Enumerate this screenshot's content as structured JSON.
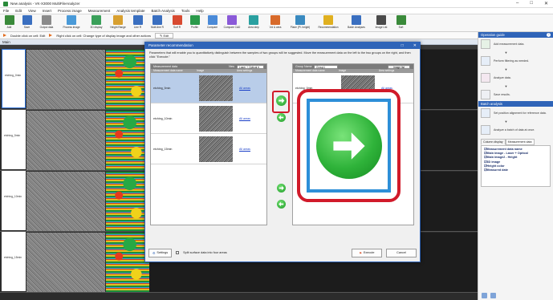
{
  "window": {
    "title": "New analysis - VK-X3000 MultiFileAnalyzer",
    "controls": [
      "–",
      "□",
      "✕"
    ]
  },
  "menu": [
    "File",
    "Edit",
    "View",
    "Insert",
    "Process image",
    "Measurement",
    "Analysis template",
    "Batch Analysis",
    "Tools",
    "Help"
  ],
  "ribbon": [
    {
      "label": "Add",
      "color": "#3a8a3a"
    },
    {
      "label": "Save",
      "color": "#3a6fc0"
    },
    {
      "label": "Output data",
      "color": "#8a8a8a"
    },
    {
      "label": "Process image",
      "color": "#4a9ad8"
    },
    {
      "label": "3D display",
      "color": "#3aa05a"
    },
    {
      "label": "Height Range",
      "color": "#d8a030"
    },
    {
      "label": "Line R",
      "color": "#3a6fc0"
    },
    {
      "label": "Multi-line R",
      "color": "#3a6fc0"
    },
    {
      "label": "Surf R",
      "color": "#d84a30"
    },
    {
      "label": "Profile",
      "color": "#2a9a4a"
    },
    {
      "label": "Compare",
      "color": "#4a8ad8"
    },
    {
      "label": "Compare CAD",
      "color": "#8a5ad8"
    },
    {
      "label": "Area step",
      "color": "#2aa0a0"
    },
    {
      "label": "Vol & area",
      "color": "#d86a2a"
    },
    {
      "label": "Plane (Pl. height)",
      "color": "#3a8ac0"
    },
    {
      "label": "Recommendation",
      "color": "#e0b020"
    },
    {
      "label": "Batch Analyses",
      "color": "#3a6fc0"
    },
    {
      "label": "Image List",
      "color": "#4a4a4a"
    },
    {
      "label": "Sort",
      "color": "#3a8a3a"
    }
  ],
  "infobar": {
    "hint1": "Double click on cell: Edit",
    "hint2": "Right click on cell: Change type of display image and other actions",
    "edit_label": "Edit"
  },
  "main_tab": "Main",
  "rows": [
    {
      "label": "etching_0min",
      "selected": true
    },
    {
      "label": "etching_5min",
      "selected": false
    },
    {
      "label": "etching_10min",
      "selected": false
    },
    {
      "label": "etching_15min",
      "selected": false
    }
  ],
  "dialog": {
    "title": "Parameter recommendation",
    "controls": [
      "□",
      "✕"
    ],
    "description": "Parameters that will enable you to quantitatively distinguish between the samples of two groups will be suggested. Move the measurement data on the left to the two groups on the right, and then click \"Execute.\"",
    "left_pane": {
      "title": "Measurement data",
      "view_label": "View",
      "view_value": "Laser + Optical",
      "headers": [
        "Measurement data name",
        "Image",
        "Area settings"
      ],
      "items": [
        {
          "name": "etching_5min",
          "area": "All areas",
          "selected": true
        },
        {
          "name": "etching_10min",
          "area": "All areas",
          "selected": false
        },
        {
          "name": "etching_15min",
          "area": "All areas",
          "selected": false
        }
      ]
    },
    "right_pane": {
      "group_label": "Group Name",
      "group_value": "Group1",
      "image_list_label": "Image list",
      "headers": [
        "Measurement data name",
        "Image",
        "Area settings"
      ],
      "items": [
        {
          "name": "etching_0min",
          "area": "All areas",
          "selected": false
        }
      ]
    },
    "settings_label": "Settings",
    "split_label": "Split surface data into four areas",
    "execute_label": "Execute",
    "cancel_label": "Cancel"
  },
  "side_panel": {
    "guide_title": "Operation guide",
    "steps": [
      {
        "text": "Add measurement data."
      },
      {
        "text": "Perform filtering as needed."
      },
      {
        "text": "Analyze data."
      },
      {
        "text": "Save results."
      }
    ],
    "batch_title": "Batch analysis",
    "batch_steps": [
      {
        "text": "Set position alignment for reference data."
      },
      {
        "text": "Analyze a batch of data at once."
      }
    ],
    "tabs": [
      "Column display",
      "Measurement data"
    ],
    "columns": [
      "Measurement data name",
      "Main image - Laser + Optical",
      "Main image2 - Height",
      "3D image",
      "Height color",
      "Measured date"
    ]
  },
  "colors": {
    "accent": "#2f64b8",
    "highlight": "#d11a2a",
    "arrow_green": "#1f9a28"
  }
}
